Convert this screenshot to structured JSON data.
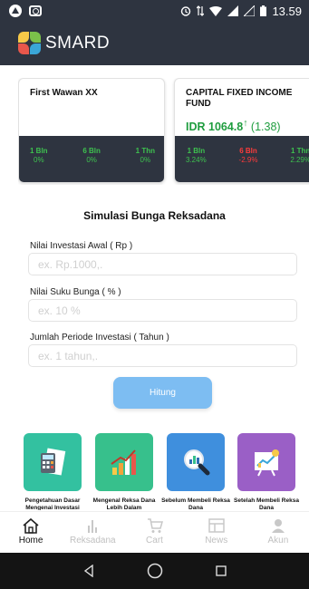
{
  "status_bar": {
    "time": "13.59"
  },
  "app": {
    "brand": "SMARD"
  },
  "funds": [
    {
      "name": "First Wawan XX",
      "price": "",
      "change": "",
      "performance": [
        {
          "label": "1 Bln",
          "value": "0%"
        },
        {
          "label": "6 Bln",
          "value": "0%"
        },
        {
          "label": "1 Thn",
          "value": "0%"
        }
      ]
    },
    {
      "name": "CAPITAL FIXED INCOME FUND",
      "price": "IDR 1064.8",
      "trend_arrow": "↑",
      "change": "(1.38)",
      "performance": [
        {
          "label": "1 Bln",
          "value": "3.24%"
        },
        {
          "label": "6 Bln",
          "value": "-2.9%"
        },
        {
          "label": "1 Thn",
          "value": "2.29%"
        }
      ]
    }
  ],
  "simulation": {
    "title": "Simulasi Bunga Reksadana",
    "fields": [
      {
        "label": "Nilai Investasi Awal ( Rp )",
        "placeholder": "ex. Rp.1000,."
      },
      {
        "label": "Nilai Suku Bunga ( % )",
        "placeholder": "ex. 10 %"
      },
      {
        "label": "Jumlah Periode Investasi ( Tahun )",
        "placeholder": "ex. 1 tahun,."
      }
    ],
    "button": "Hitung"
  },
  "tiles": [
    {
      "caption": "Pengetahuan Dasar Mengenai Investasi",
      "icon": "calculator-document-icon"
    },
    {
      "caption": "Mengenal Reksa Dana Lebih Dalam",
      "icon": "growth-chart-icon"
    },
    {
      "caption": "Sebelum Membeli Reksa Dana",
      "icon": "magnifier-chart-icon"
    },
    {
      "caption": "Setelah Membeli Reksa Dana",
      "icon": "presentation-board-icon"
    }
  ],
  "bottom_nav": [
    {
      "label": "Home",
      "icon": "home-icon",
      "active": true
    },
    {
      "label": "Reksadana",
      "icon": "bar-chart-icon",
      "active": false
    },
    {
      "label": "Cart",
      "icon": "cart-icon",
      "active": false
    },
    {
      "label": "News",
      "icon": "news-icon",
      "active": false
    },
    {
      "label": "Akun",
      "icon": "user-icon",
      "active": false
    }
  ],
  "colors": {
    "header": "#2e3440",
    "positive": "#1f9d3f",
    "negative": "#ff3b3b",
    "button": "#7dbdf2"
  }
}
